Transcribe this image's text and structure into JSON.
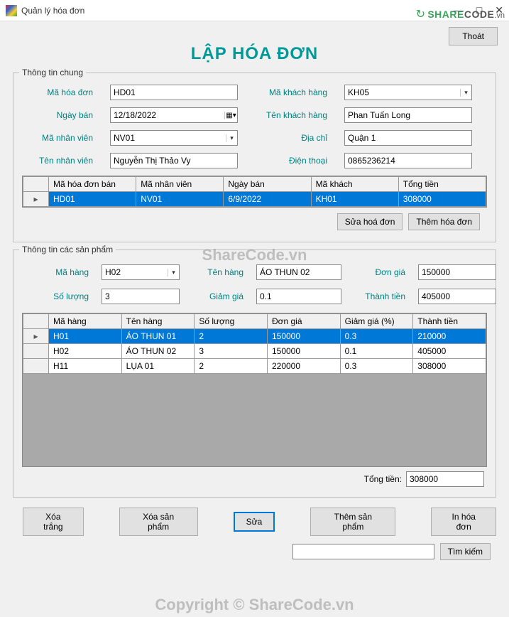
{
  "window": {
    "title": "Quản lý hóa đơn",
    "min": "—",
    "max": "□",
    "close": "✕"
  },
  "brand": {
    "pre": "SHARE",
    "post": "CODE",
    "suffix": ".vn"
  },
  "exit_label": "Thoát",
  "page_title": "LẬP HÓA ĐƠN",
  "general": {
    "legend": "Thông tin chung",
    "labels": {
      "mahd": "Mã hóa đơn",
      "ngayban": "Ngày bán",
      "manv": "Mã nhân viên",
      "tennv": "Tên nhân viên",
      "makh": "Mã khách hàng",
      "tenkh": "Tên khách hàng",
      "diachi": "Địa chỉ",
      "dienthoai": "Điện thoại"
    },
    "values": {
      "mahd": "HD01",
      "ngayban": "12/18/2022",
      "manv": "NV01",
      "tennv": "Nguyễn Thị Thảo Vy",
      "makh": "KH05",
      "tenkh": "Phan Tuấn Long",
      "diachi": "Quận 1",
      "dienthoai": "0865236214"
    }
  },
  "invoice_grid": {
    "headers": [
      "Mã hóa đơn bán",
      "Mã nhân viên",
      "Ngày bán",
      "Mã khách",
      "Tổng tiền"
    ],
    "rows": [
      {
        "cells": [
          "HD01",
          "NV01",
          "6/9/2022",
          "KH01",
          "308000"
        ],
        "selected": true
      }
    ]
  },
  "invoice_buttons": {
    "edit": "Sửa hoá đơn",
    "add": "Thêm hóa đơn"
  },
  "products": {
    "legend": "Thông tin các sản phẩm",
    "labels": {
      "mahang": "Mã hàng",
      "tenhang": "Tên hàng",
      "dongia": "Đơn giá",
      "soluong": "Số lượng",
      "giamgia": "Giảm giá",
      "thanhtien": "Thành tiền"
    },
    "values": {
      "mahang": "H02",
      "tenhang": "ÁO THUN 02",
      "dongia": "150000",
      "soluong": "3",
      "giamgia": "0.1",
      "thanhtien": "405000"
    }
  },
  "product_grid": {
    "headers": [
      "Mã hàng",
      "Tên hàng",
      "Số lượng",
      "Đơn giá",
      "Giảm giá (%)",
      "Thành tiền"
    ],
    "rows": [
      {
        "cells": [
          "H01",
          "ÁO THUN 01",
          "2",
          "150000",
          "0.3",
          "210000"
        ],
        "selected": true
      },
      {
        "cells": [
          "H02",
          "ÁO THUN 02",
          "3",
          "150000",
          "0.1",
          "405000"
        ],
        "selected": false
      },
      {
        "cells": [
          "H11",
          "LỤA 01",
          "2",
          "220000",
          "0.3",
          "308000"
        ],
        "selected": false
      }
    ]
  },
  "total": {
    "label": "Tổng tiền:",
    "value": "308000"
  },
  "bottom_buttons": {
    "clear": "Xóa trắng",
    "delprod": "Xóa sản phẩm",
    "edit": "Sửa",
    "addprod": "Thêm sản phẩm",
    "print": "In hóa đơn"
  },
  "search": {
    "value": "",
    "button": "Tìm kiếm"
  },
  "watermark": {
    "text1": "ShareCode.vn",
    "text2": "Copyright © ShareCode.vn"
  }
}
